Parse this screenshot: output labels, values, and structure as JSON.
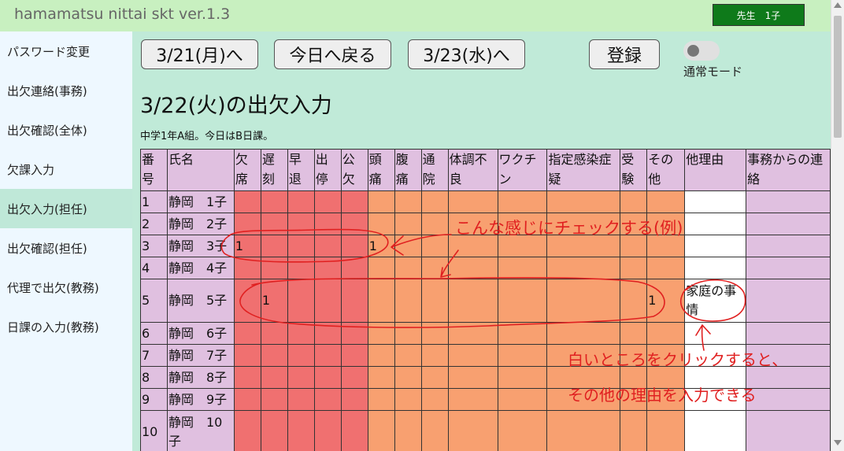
{
  "header": {
    "app_title": "hamamatsu nittai skt ver.1.3",
    "user_badge": "先生　1子",
    "bg_color": "#c8f0c0",
    "badge_color": "#0e7a1a"
  },
  "sidebar": {
    "items": [
      {
        "label": "パスワード変更",
        "active": false
      },
      {
        "label": "出欠連絡(事務)",
        "active": false
      },
      {
        "label": "出欠確認(全体)",
        "active": false
      },
      {
        "label": "欠課入力",
        "active": false
      },
      {
        "label": "出欠入力(担任)",
        "active": true
      },
      {
        "label": "出欠確認(担任)",
        "active": false
      },
      {
        "label": "代理で出欠(教務)",
        "active": false
      },
      {
        "label": "日課の入力(教務)",
        "active": false
      }
    ]
  },
  "toolbar": {
    "prev_day_label": "3/21(月)へ",
    "today_label": "今日へ戻る",
    "next_day_label": "3/23(水)へ",
    "register_label": "登録",
    "mode_label": "通常モード"
  },
  "main": {
    "title": "3/22(火)の出欠入力",
    "subtitle": "中学1年A組。今日はB日課。"
  },
  "table": {
    "headers": [
      "番号",
      "氏名",
      "欠席",
      "遅刻",
      "早退",
      "出停",
      "公欠",
      "頭痛",
      "腹痛",
      "通院",
      "体調不良",
      "ワクチン",
      "指定感染症疑",
      "受験",
      "その他",
      "他理由",
      "事務からの連絡"
    ],
    "rows": [
      {
        "no": "1",
        "name": "静岡　1子",
        "cells": [
          "",
          "",
          "",
          "",
          "",
          "",
          "",
          "",
          "",
          "",
          "",
          "",
          ""
        ],
        "reason": "",
        "note": ""
      },
      {
        "no": "2",
        "name": "静岡　2子",
        "cells": [
          "",
          "",
          "",
          "",
          "",
          "",
          "",
          "",
          "",
          "",
          "",
          "",
          ""
        ],
        "reason": "",
        "note": ""
      },
      {
        "no": "3",
        "name": "静岡　3子",
        "cells": [
          "1",
          "",
          "",
          "",
          "",
          "1",
          "",
          "",
          "",
          "",
          "",
          "",
          ""
        ],
        "reason": "",
        "note": ""
      },
      {
        "no": "4",
        "name": "静岡　4子",
        "cells": [
          "",
          "",
          "",
          "",
          "",
          "",
          "",
          "",
          "",
          "",
          "",
          "",
          ""
        ],
        "reason": "",
        "note": ""
      },
      {
        "no": "5",
        "name": "静岡　5子",
        "cells": [
          "",
          "1",
          "",
          "",
          "",
          "",
          "",
          "",
          "",
          "",
          "",
          "",
          "1"
        ],
        "reason": "家庭の事情",
        "note": ""
      },
      {
        "no": "6",
        "name": "静岡　6子",
        "cells": [
          "",
          "",
          "",
          "",
          "",
          "",
          "",
          "",
          "",
          "",
          "",
          "",
          ""
        ],
        "reason": "",
        "note": ""
      },
      {
        "no": "7",
        "name": "静岡　7子",
        "cells": [
          "",
          "",
          "",
          "",
          "",
          "",
          "",
          "",
          "",
          "",
          "",
          "",
          ""
        ],
        "reason": "",
        "note": ""
      },
      {
        "no": "8",
        "name": "静岡　8子",
        "cells": [
          "",
          "",
          "",
          "",
          "",
          "",
          "",
          "",
          "",
          "",
          "",
          "",
          ""
        ],
        "reason": "",
        "note": ""
      },
      {
        "no": "9",
        "name": "静岡　9子",
        "cells": [
          "",
          "",
          "",
          "",
          "",
          "",
          "",
          "",
          "",
          "",
          "",
          "",
          ""
        ],
        "reason": "",
        "note": ""
      },
      {
        "no": "10",
        "name": "静岡　10子",
        "cells": [
          "",
          "",
          "",
          "",
          "",
          "",
          "",
          "",
          "",
          "",
          "",
          "",
          ""
        ],
        "reason": "",
        "note": ""
      }
    ]
  },
  "annotations": {
    "example_note": "こんな感じにチェックする(例)",
    "click_note_1": "白いところをクリックすると、",
    "click_note_2": "その他の理由を入力できる",
    "color": "#e02020"
  },
  "colors": {
    "sidebar_bg": "#eef8ff",
    "sidebar_active": "#bfe8d8",
    "main_bg": "#c0ead8",
    "header_cell": "#e0c0e0",
    "absence_cell": "#f07070",
    "reason_cell": "#f8a070"
  }
}
